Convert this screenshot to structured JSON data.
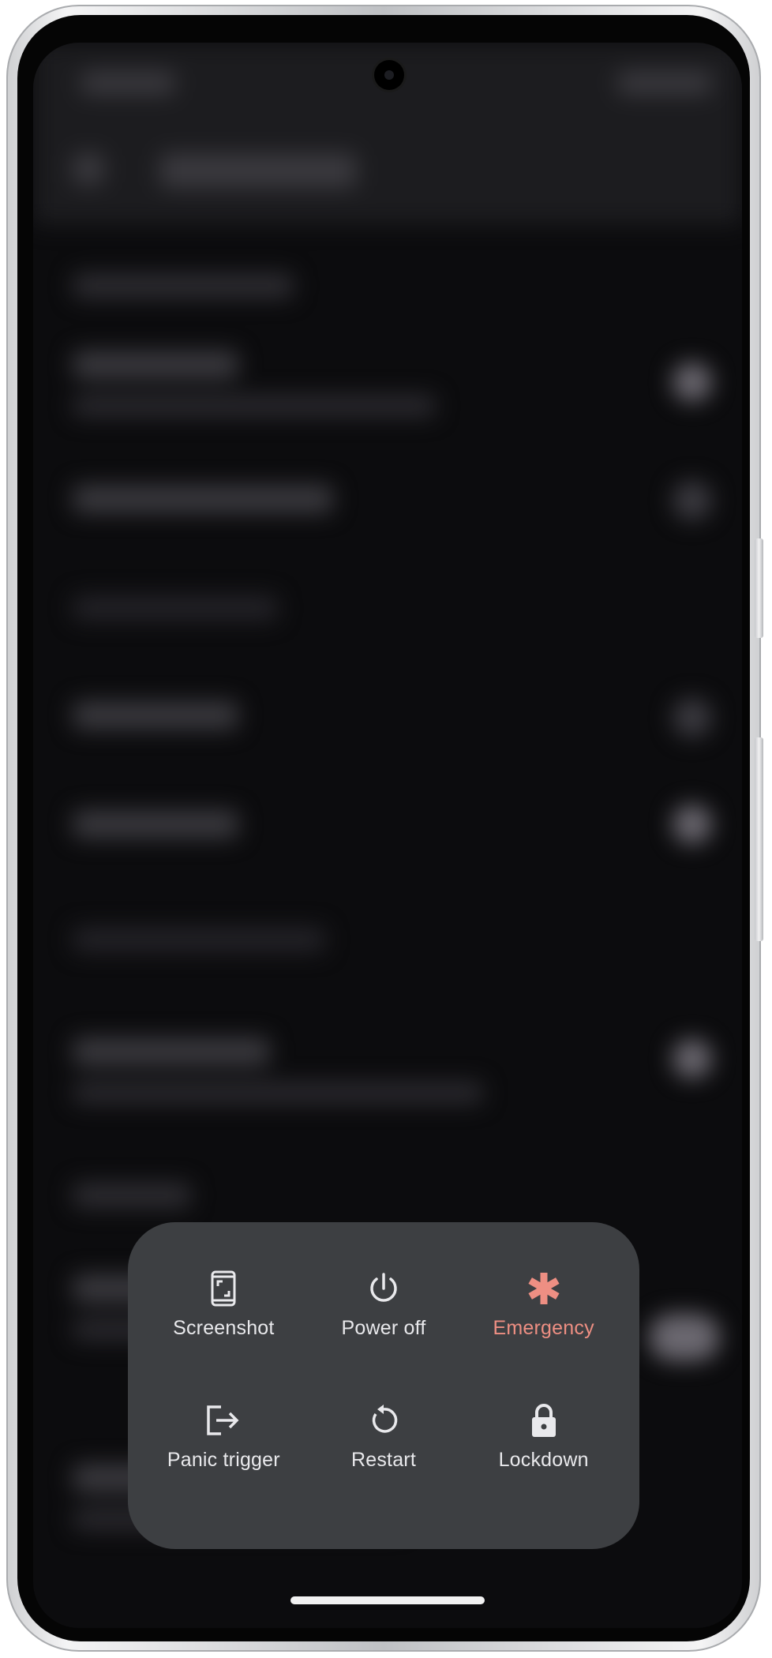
{
  "device": {
    "frame_color": "#c9cbce",
    "screen_color": "#0c0c0e"
  },
  "power_menu": {
    "background": "#3d3f42",
    "actions": [
      {
        "label": "Screenshot",
        "icon": "screenshot-icon",
        "color": "#e9e9ec"
      },
      {
        "label": "Power off",
        "icon": "power-icon",
        "color": "#e9e9ec"
      },
      {
        "label": "Emergency",
        "icon": "emergency-asterisk-icon",
        "color": "#ee8f83"
      },
      {
        "label": "Panic trigger",
        "icon": "exit-arrow-icon",
        "color": "#e9e9ec"
      },
      {
        "label": "Restart",
        "icon": "restart-icon",
        "color": "#e9e9ec"
      },
      {
        "label": "Lockdown",
        "icon": "lock-icon",
        "color": "#e9e9ec"
      }
    ]
  }
}
